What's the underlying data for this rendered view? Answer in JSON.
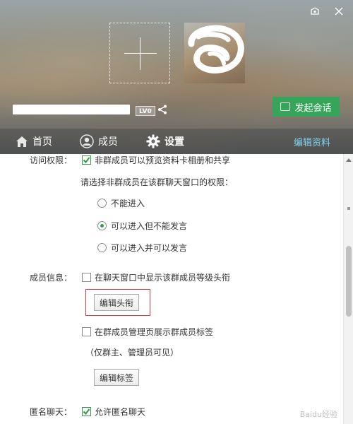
{
  "header": {
    "level_badge": "LV0",
    "chat_button_label": "发起会话",
    "tabs": [
      {
        "label": "首页",
        "icon": "home-icon"
      },
      {
        "label": "成员",
        "icon": "person-icon"
      },
      {
        "label": "设置",
        "icon": "gear-icon"
      }
    ],
    "edit_info_label": "编辑资料",
    "chat_button_color": "#35a659"
  },
  "settings": {
    "access": {
      "label": "访问权限：",
      "preview_checkbox_label": "非群成员可以预览资料卡相册和共享",
      "preview_checked": true,
      "prompt": "请选择非群成员在该群聊天窗口的权限：",
      "options": [
        {
          "label": "不能进入",
          "selected": false
        },
        {
          "label": "可以进入但不能发言",
          "selected": true
        },
        {
          "label": "可以进入并可以发言",
          "selected": false
        }
      ]
    },
    "member_info": {
      "label": "成员信息：",
      "show_level_label": "在聊天窗口中显示该群成员等级头衔",
      "show_level_checked": false,
      "edit_title_button": "编辑头衔",
      "show_tag_label": "在群成员管理页展示群成员标签",
      "show_tag_checked": false,
      "tag_note": "（仅群主、管理员可见）",
      "edit_tag_button": "编辑标签"
    },
    "anonymous": {
      "label": "匿名聊天：",
      "allow_label": "允许匿名聊天",
      "allow_checked": true
    }
  },
  "watermark": "Baidu经验"
}
